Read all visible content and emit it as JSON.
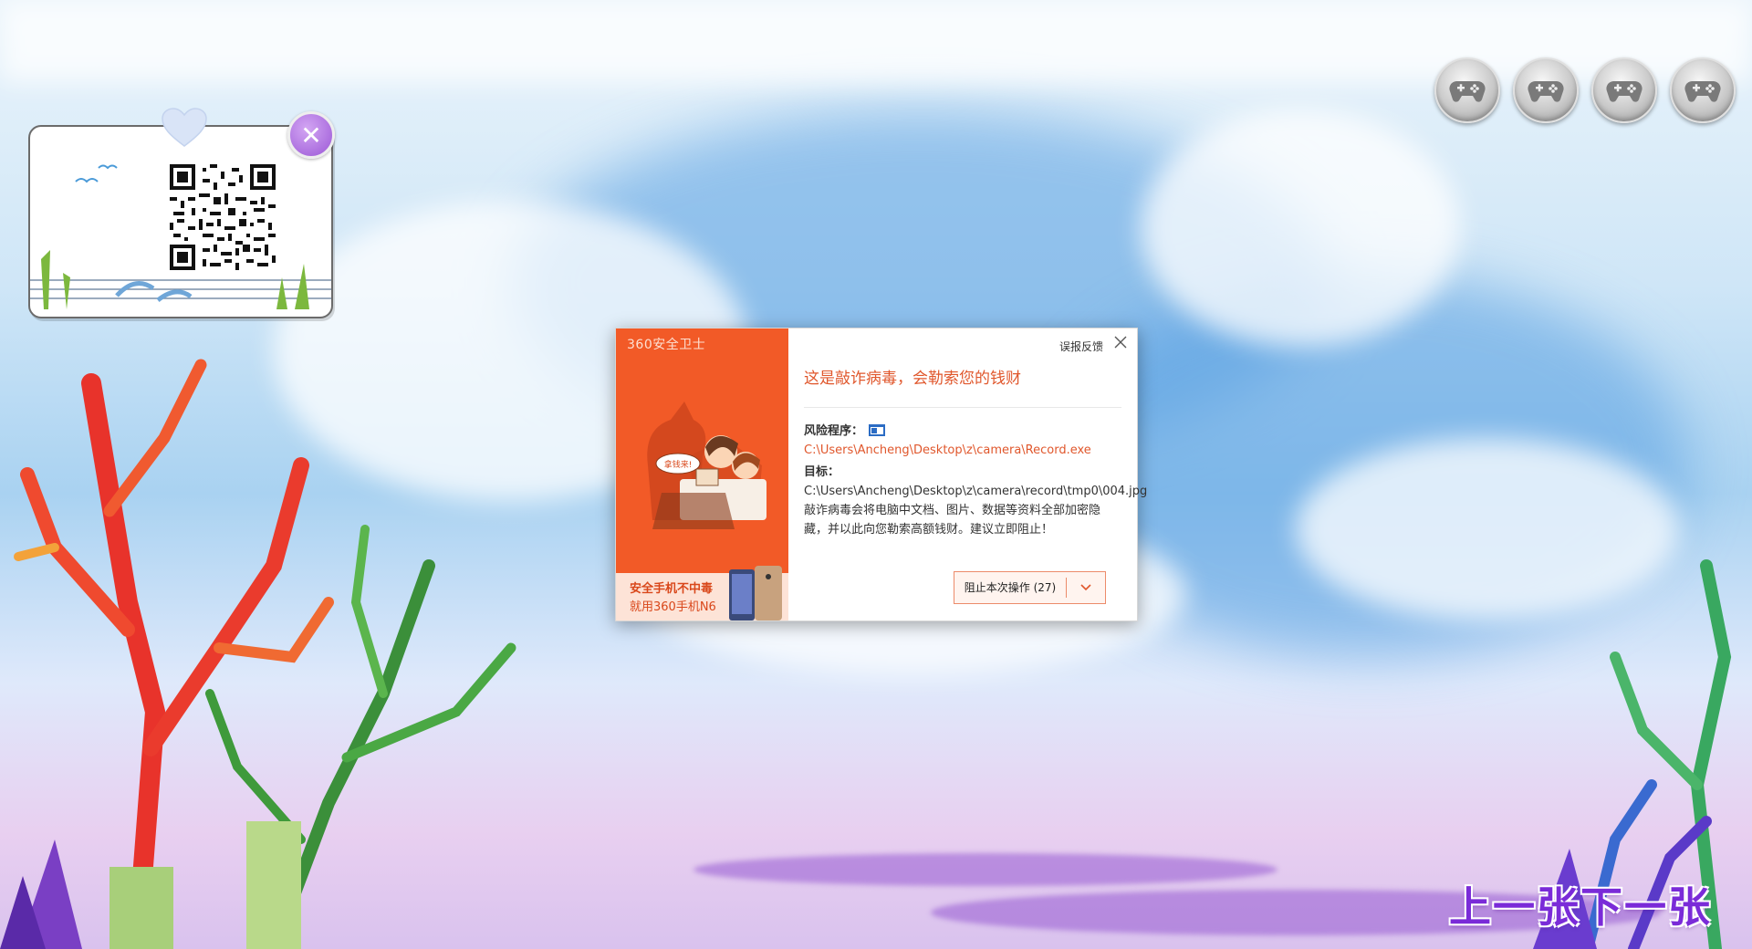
{
  "qr_card": {
    "close_symbol": "✕"
  },
  "game_buttons": [
    {
      "icon": "gamepad-icon"
    },
    {
      "icon": "gamepad-icon"
    },
    {
      "icon": "gamepad-icon"
    },
    {
      "icon": "gamepad-icon"
    }
  ],
  "dialog": {
    "brand": "360安全卫士",
    "bubble_text": "拿钱来!",
    "promo_line1": "安全手机不中毒",
    "promo_line2": "就用360手机N6",
    "feedback": "误报反馈",
    "title": "这是敲诈病毒，会勒索您的钱财",
    "risk_label": "风险程序：",
    "risk_path": "C:\\Users\\Ancheng\\Desktop\\z\\camera\\Record.exe",
    "target_label": "目标：",
    "target_path": "C:\\Users\\Ancheng\\Desktop\\z\\camera\\record\\tmp0\\004.jpg",
    "description": "敲诈病毒会将电脑中文档、图片、数据等资料全部加密隐藏，并以此向您勒索高额钱财。建议立即阻止！",
    "block_button": "阻止本次操作 (27)",
    "accent_color": "#f25a27"
  },
  "nav": {
    "prev": "上一张",
    "next": "下一张"
  }
}
